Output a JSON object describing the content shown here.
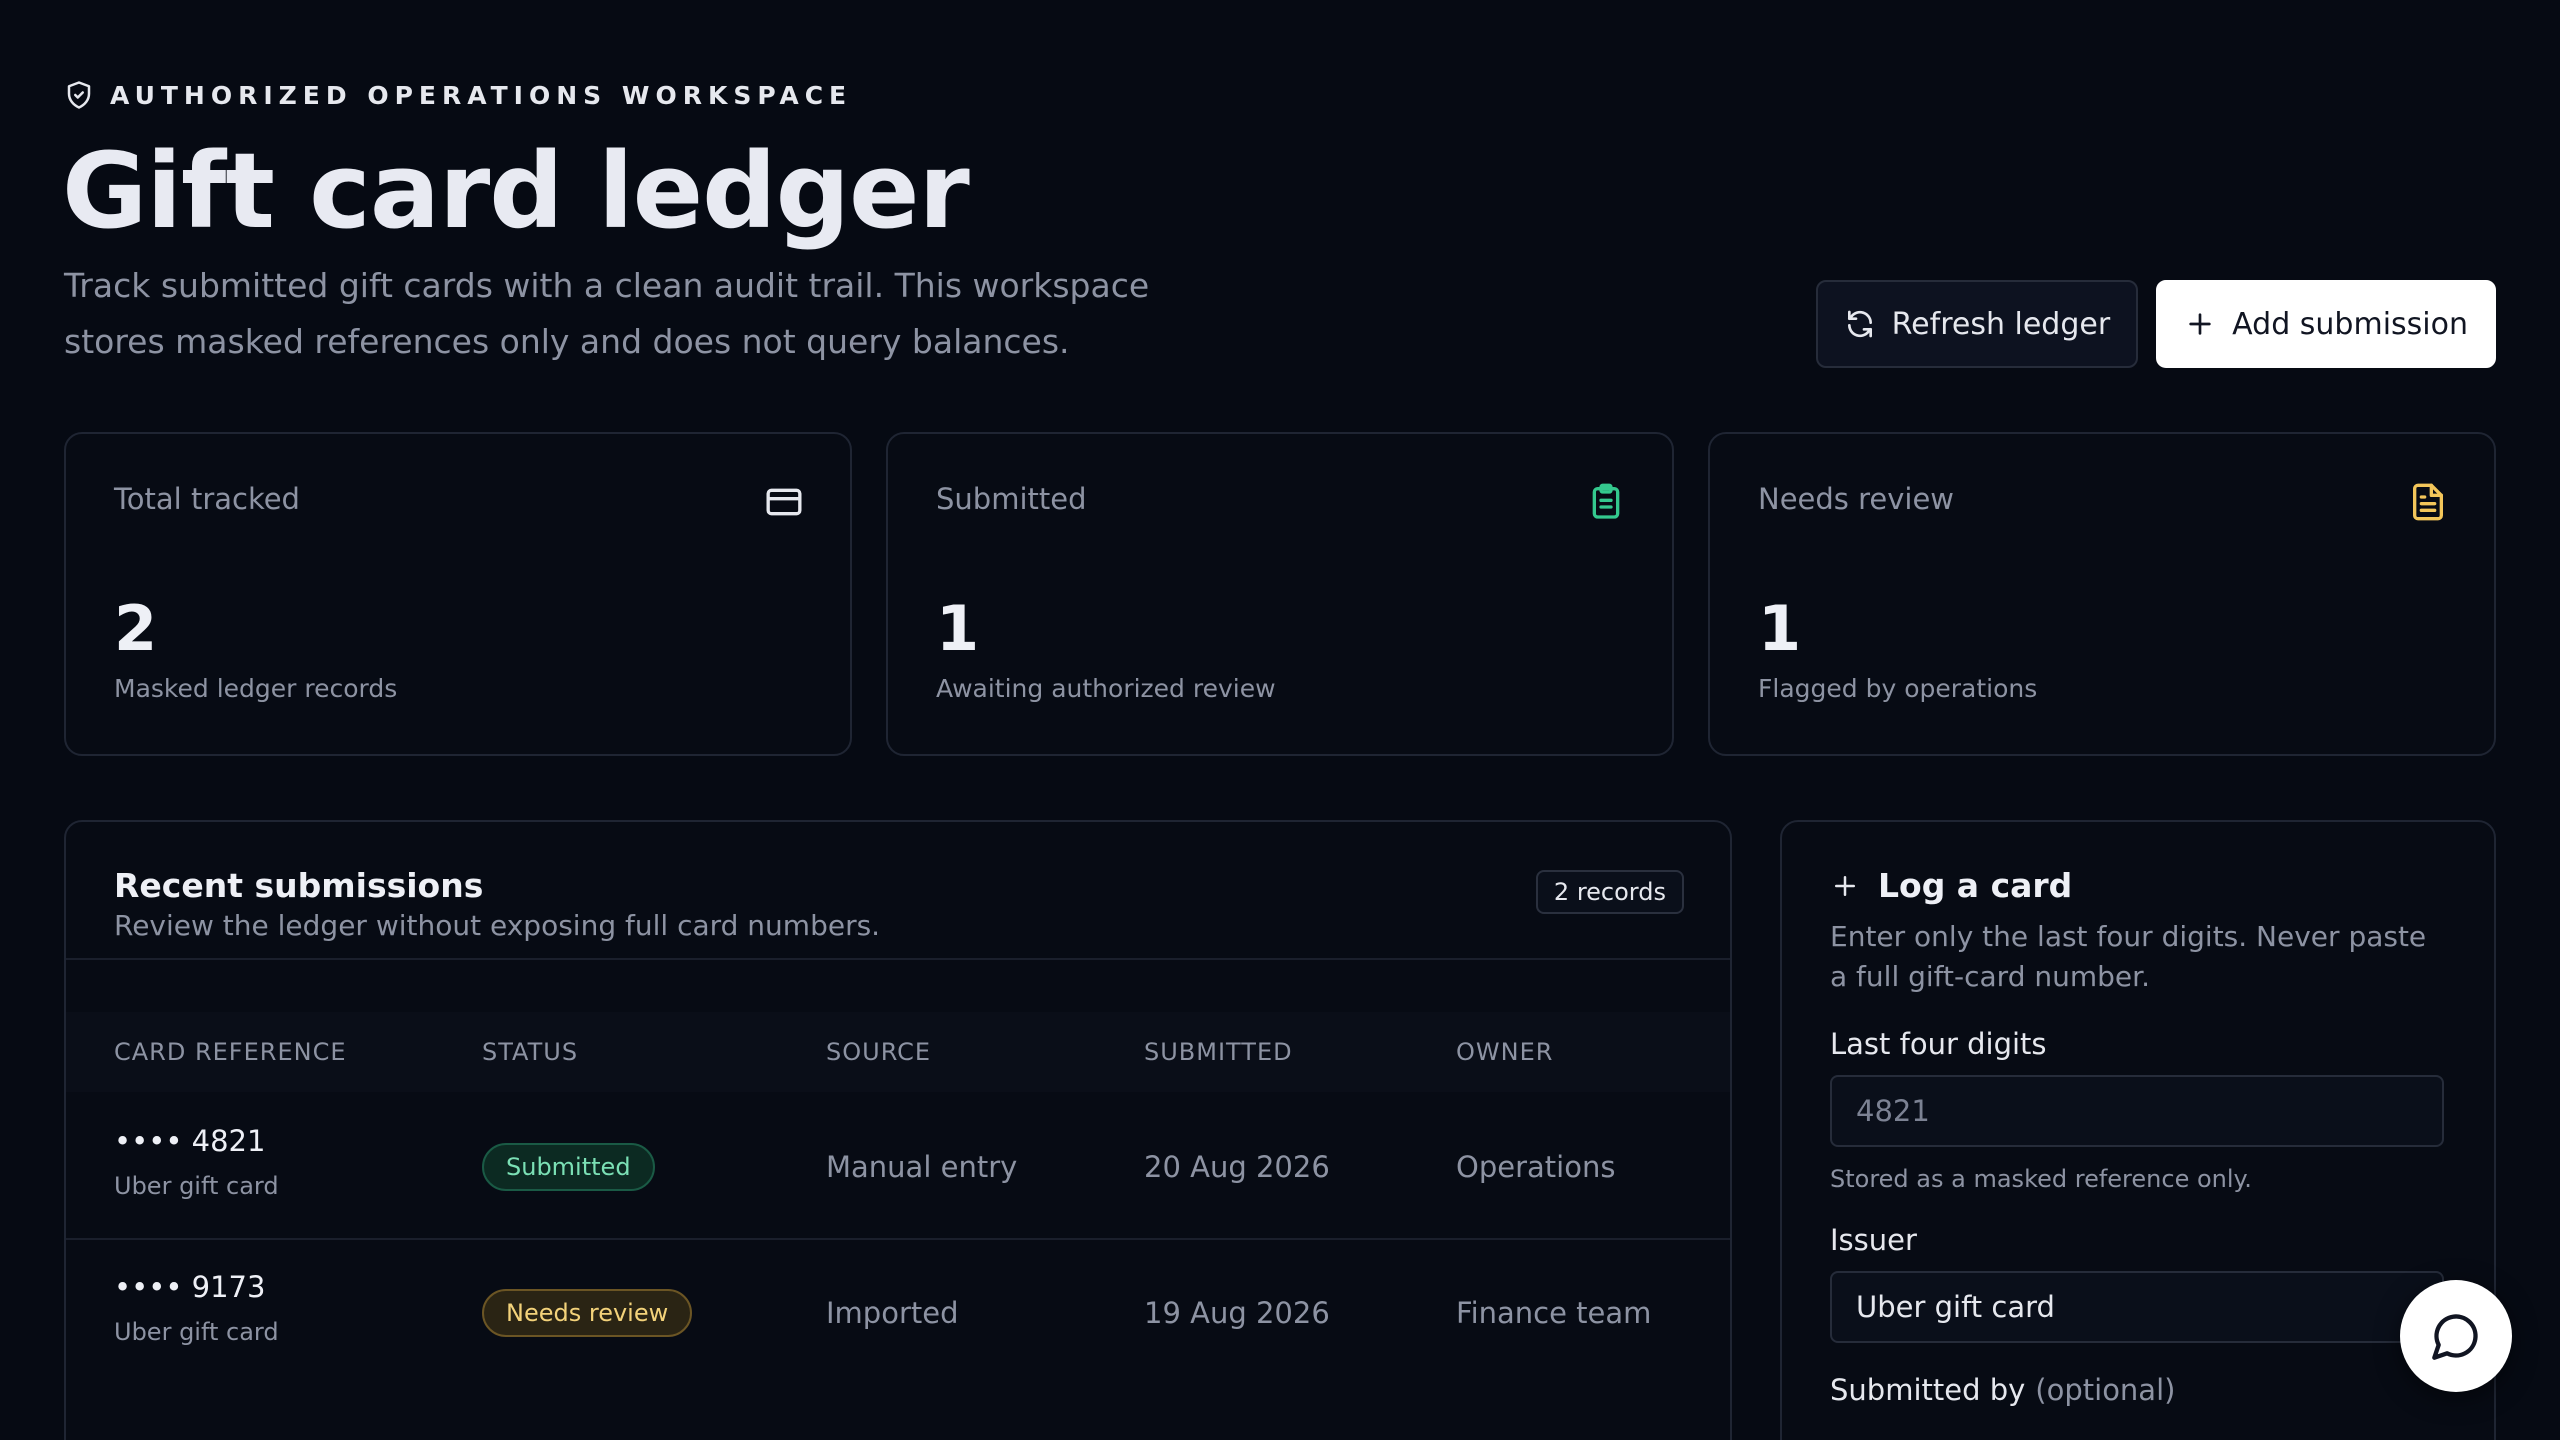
{
  "header": {
    "eyebrow": "AUTHORIZED OPERATIONS WORKSPACE",
    "title": "Gift card ledger",
    "subtitle": "Track submitted gift cards with a clean audit trail. This workspace stores masked references only and does not query balances.",
    "refresh_label": "Refresh ledger",
    "add_label": "Add submission"
  },
  "stats": [
    {
      "label": "Total tracked",
      "value": "2",
      "caption": "Masked ledger records",
      "icon": "credit-card-icon"
    },
    {
      "label": "Submitted",
      "value": "1",
      "caption": "Awaiting authorized review",
      "icon": "clipboard-list-icon"
    },
    {
      "label": "Needs review",
      "value": "1",
      "caption": "Flagged by operations",
      "icon": "file-text-icon"
    }
  ],
  "colors": {
    "submitted_icon": "#34c98e",
    "review_icon": "#f3c65a"
  },
  "table": {
    "title": "Recent submissions",
    "subtitle": "Review the ledger without exposing full card numbers.",
    "records_badge": "2 records",
    "columns": [
      "CARD REFERENCE",
      "STATUS",
      "SOURCE",
      "SUBMITTED",
      "OWNER"
    ],
    "rows": [
      {
        "ref": "•••• 4821",
        "issuer": "Uber gift card",
        "status": "Submitted",
        "source": "Manual entry",
        "submitted": "20 Aug 2026",
        "owner": "Operations"
      },
      {
        "ref": "•••• 9173",
        "issuer": "Uber gift card",
        "status": "Needs review",
        "source": "Imported",
        "submitted": "19 Aug 2026",
        "owner": "Finance team"
      }
    ]
  },
  "form": {
    "title": "Log a card",
    "description": "Enter only the last four digits. Never paste a full gift-card number.",
    "last_four_label": "Last four digits",
    "last_four_placeholder": "4821",
    "last_four_hint": "Stored as a masked reference only.",
    "issuer_label": "Issuer",
    "issuer_value": "Uber gift card",
    "submitted_by_label": "Submitted by",
    "submitted_by_optional": "(optional)"
  }
}
